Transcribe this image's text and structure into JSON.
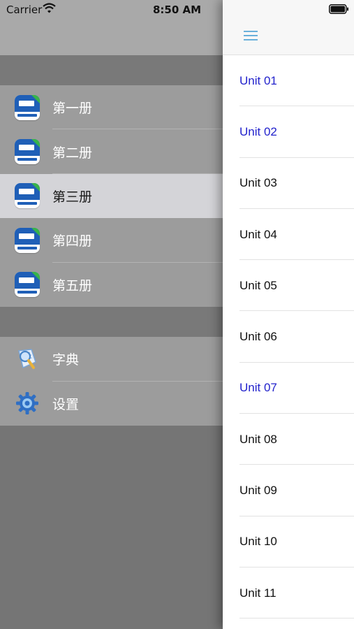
{
  "status_bar": {
    "carrier": "Carrier",
    "time": "8:50 AM"
  },
  "side_menu": {
    "books": [
      {
        "label": "第一册",
        "selected": false
      },
      {
        "label": "第二册",
        "selected": false
      },
      {
        "label": "第三册",
        "selected": true
      },
      {
        "label": "第四册",
        "selected": false
      },
      {
        "label": "第五册",
        "selected": false
      }
    ],
    "tools": [
      {
        "label": "字典",
        "icon": "dictionary-icon"
      },
      {
        "label": "设置",
        "icon": "gear-icon"
      }
    ]
  },
  "unit_list": {
    "menu_icon": "hamburger-icon",
    "units": [
      {
        "label": "Unit 01",
        "visited": true
      },
      {
        "label": "Unit 02",
        "visited": true
      },
      {
        "label": "Unit 03",
        "visited": false
      },
      {
        "label": "Unit 04",
        "visited": false
      },
      {
        "label": "Unit 05",
        "visited": false
      },
      {
        "label": "Unit 06",
        "visited": false
      },
      {
        "label": "Unit 07",
        "visited": true
      },
      {
        "label": "Unit 08",
        "visited": false
      },
      {
        "label": "Unit 09",
        "visited": false
      },
      {
        "label": "Unit 10",
        "visited": false
      },
      {
        "label": "Unit 11",
        "visited": false
      }
    ]
  },
  "colors": {
    "visited_link": "#2222cc",
    "hamburger": "#5aa8d8",
    "book_cover": "#1f5fb7",
    "book_badge": "#38b34a"
  }
}
